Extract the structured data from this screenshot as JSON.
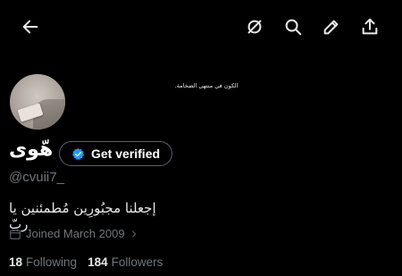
{
  "header": {
    "back_icon": "back-arrow-icon",
    "actions": [
      "grok-icon",
      "search-icon",
      "edit-icon",
      "share-icon"
    ]
  },
  "banner": {
    "text": "الكون في منتهى الضخامة."
  },
  "profile": {
    "display_name": "هّوى",
    "verify_label": "Get verified",
    "handle": "@cvuii7_",
    "bio": "إجعلنا مجبُورِين مُطمئنين يا ربّ",
    "joined": "Joined March 2009",
    "following_count": "18",
    "following_label": "Following",
    "followers_count": "184",
    "followers_label": "Followers"
  },
  "colors": {
    "background": "#000000",
    "text": "#e7e9ea",
    "muted": "#71767b",
    "badge": "#1d9bf0"
  }
}
